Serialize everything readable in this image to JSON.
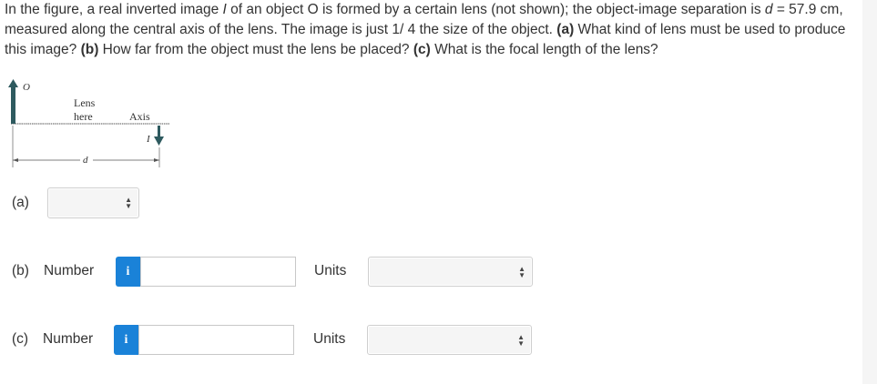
{
  "question": {
    "text_1": "In the figure, a real inverted image ",
    "var_I": "I",
    "text_2": " of an object ",
    "var_O": "O",
    "text_3": " is formed by a certain lens (not shown); the object-image separation is ",
    "var_d": "d",
    "text_4": " = 57.9 cm, measured along the central axis of the lens. The image is just 1/ 4 the size of the object. ",
    "part_a_tag": "(a)",
    "text_5": " What kind of lens must be used to produce this image? ",
    "part_b_tag": "(b)",
    "text_6": " How far from the object must the lens be placed? ",
    "part_c_tag": "(c)",
    "text_7": " What is the focal length of the lens?"
  },
  "figure": {
    "object_label": "O",
    "lens_label_line1": "Lens",
    "lens_label_line2": "here",
    "axis_label": "Axis",
    "image_label": "I",
    "distance_label": "d"
  },
  "part_a": {
    "label": "(a)",
    "selected": ""
  },
  "part_b": {
    "label": "(b)",
    "number_label": "Number",
    "info_icon": "i",
    "value": "",
    "units_label": "Units",
    "units_selected": ""
  },
  "part_c": {
    "label": "(c)",
    "number_label": "Number",
    "info_icon": "i",
    "value": "",
    "units_label": "Units",
    "units_selected": ""
  },
  "colors": {
    "info_button": "#1a82d8",
    "object_arrow": "#2e5a5f",
    "text": "#333333"
  },
  "icons": {
    "select_arrows": "up-down-arrows-icon",
    "info": "info-icon"
  }
}
